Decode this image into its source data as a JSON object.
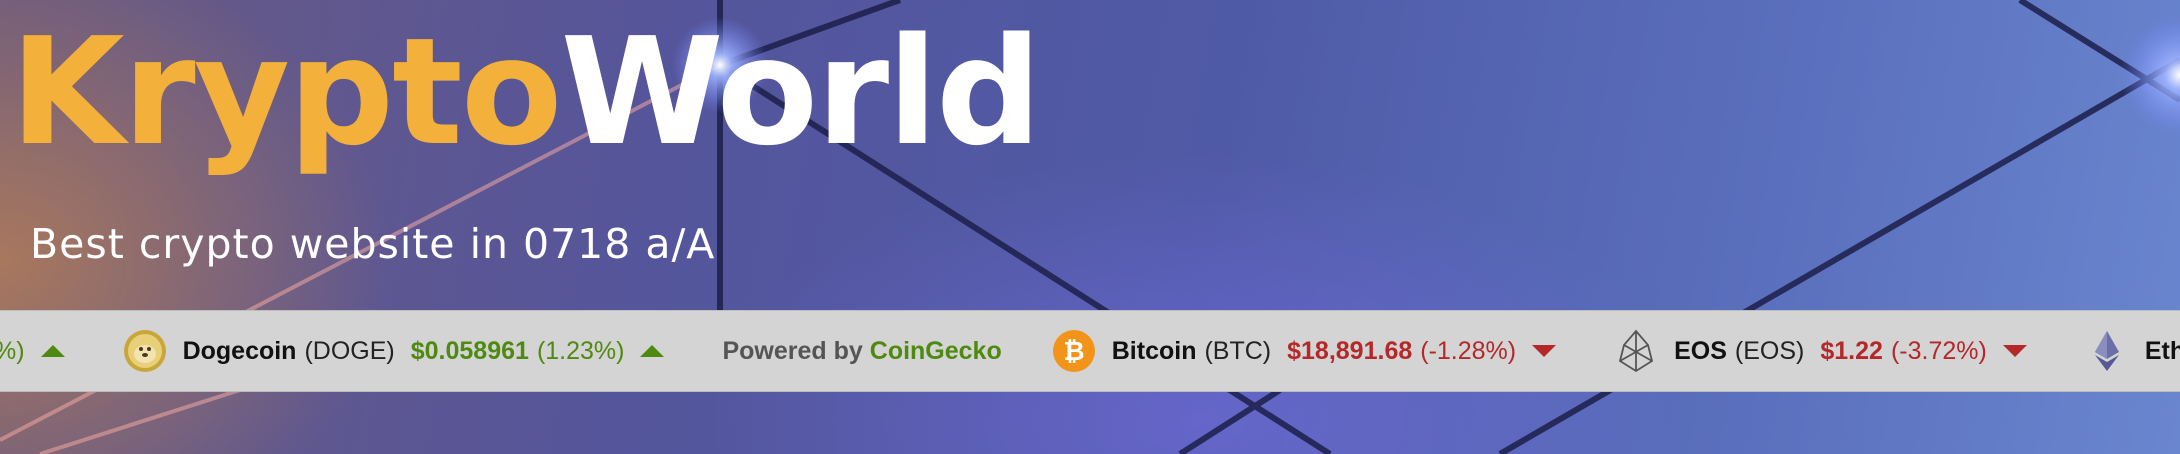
{
  "hero": {
    "title_part1": "Krypto",
    "title_part2": "World",
    "tagline": "Best crypto website in 0718 a/A"
  },
  "ticker": {
    "partial_leading_change": "%)",
    "items": [
      {
        "icon": "dogecoin-icon",
        "name": "Dogecoin",
        "symbol": "(DOGE)",
        "price": "$0.058961",
        "change": "(1.23%)",
        "direction": "up"
      },
      {
        "icon": "bitcoin-icon",
        "name": "Bitcoin",
        "symbol": "(BTC)",
        "price": "$18,891.68",
        "change": "(-1.28%)",
        "direction": "down"
      },
      {
        "icon": "eos-icon",
        "name": "EOS",
        "symbol": "(EOS)",
        "price": "$1.22",
        "change": "(-3.72%)",
        "direction": "down"
      }
    ],
    "powered_prefix": "Powered by",
    "powered_brand": "CoinGecko",
    "partial_trailing_name": "Ethe",
    "trailing_icon": "ethereum-icon"
  },
  "colors": {
    "brand_orange": "#f3b03a",
    "up_green": "#4f8a10",
    "down_red": "#b5282a",
    "ticker_bg": "#d4d4d4"
  }
}
